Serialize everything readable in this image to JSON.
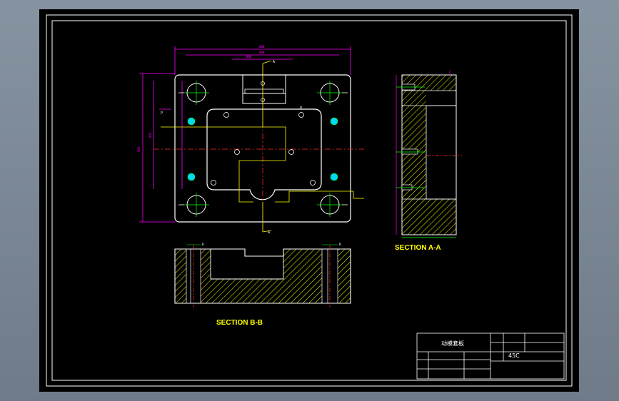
{
  "drawing": {
    "section_a_label": "SECTION A-A",
    "section_b_label": "SECTION B-B",
    "marker_a_top": "A",
    "marker_a_bottom": "A",
    "marker_b_left": "B",
    "marker_b_right": "B",
    "hole_label": "P",
    "colors": {
      "outline": "#ffffff",
      "dimension": "#ff00ff",
      "centerline": "#ff2a2a",
      "section_line": "#ffff00",
      "hatch": "#ffff00",
      "green": "#00ff00",
      "cyan": "#00d8ff"
    }
  },
  "title_block": {
    "part_name": "动模套板",
    "material_value": "45C"
  }
}
